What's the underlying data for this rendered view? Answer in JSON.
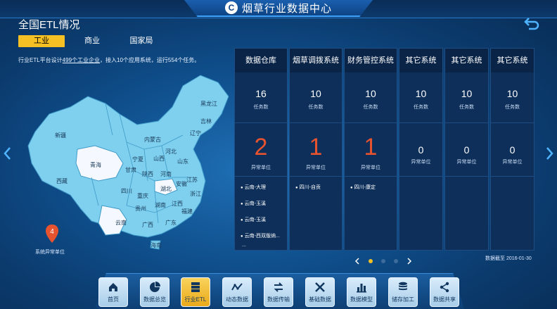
{
  "header": {
    "app_title": "烟草行业数据中心",
    "logo_text": "C"
  },
  "page": {
    "title": "全国ETL情况",
    "tabs": [
      "工业",
      "商业",
      "国家局"
    ],
    "active_tab": 0,
    "description_prefix": "行业ETL平台设计",
    "description_link": "499个工业企业",
    "description_suffix": "，接入10个应用系统，运行554个任务。"
  },
  "map": {
    "regions": [
      "黑龙江",
      "吉林",
      "辽宁",
      "内蒙古",
      "新疆",
      "河北",
      "山西",
      "山东",
      "青海",
      "宁夏",
      "甘肃",
      "陕西",
      "河南",
      "江苏",
      "西藏",
      "四川",
      "湖北",
      "安徽",
      "浙江",
      "重庆",
      "贵州",
      "湖南",
      "江西",
      "福建",
      "云南",
      "广西",
      "广东",
      "海南"
    ],
    "highlight_color": "#f5f9ff",
    "base_color": "#7fd0ee",
    "pin_count": "4",
    "pin_label": "系统异常单位"
  },
  "cards": [
    {
      "name": "数据仓库",
      "tasks": "16",
      "tasks_label": "任务数",
      "errors": "2",
      "errors_label": "异常单位",
      "units": [
        "云南-大理",
        "云南-玉溪",
        "云南-玉溪",
        "云南-西双版纳..."
      ],
      "more": "..."
    },
    {
      "name": "烟草调拨系统",
      "tasks": "10",
      "tasks_label": "任务数",
      "errors": "1",
      "errors_label": "异常单位",
      "units": [
        "四川-自贡"
      ],
      "more": ""
    },
    {
      "name": "财务管控系统",
      "tasks": "10",
      "tasks_label": "任务数",
      "errors": "1",
      "errors_label": "异常单位",
      "units": [
        "四川-康定"
      ],
      "more": ""
    },
    {
      "name": "其它系统",
      "tasks": "10",
      "tasks_label": "任务数",
      "errors": "0",
      "errors_label": "异常单位",
      "units": [],
      "more": ""
    },
    {
      "name": "其它系统",
      "tasks": "10",
      "tasks_label": "任务数",
      "errors": "0",
      "errors_label": "异常单位",
      "units": [],
      "more": ""
    },
    {
      "name": "其它系统",
      "tasks": "10",
      "tasks_label": "任务数",
      "errors": "0",
      "errors_label": "异常单位",
      "units": [],
      "more": ""
    }
  ],
  "pager": {
    "pages": 3,
    "current": 0
  },
  "date_text": "数据截至  2016-01-30",
  "dock": [
    {
      "label": "首页",
      "icon": "home-icon"
    },
    {
      "label": "数据总览",
      "icon": "pie-icon"
    },
    {
      "label": "行业ETL",
      "icon": "server-icon",
      "active": true
    },
    {
      "label": "动态数据",
      "icon": "wave-icon"
    },
    {
      "label": "数据传输",
      "icon": "transfer-icon"
    },
    {
      "label": "基础数据",
      "icon": "tools-icon"
    },
    {
      "label": "数据模型",
      "icon": "bar-icon"
    },
    {
      "label": "储存加工",
      "icon": "database-icon"
    },
    {
      "label": "数据共享",
      "icon": "share-icon"
    }
  ],
  "colors": {
    "accent": "#f5c023",
    "error": "#e8532f"
  }
}
